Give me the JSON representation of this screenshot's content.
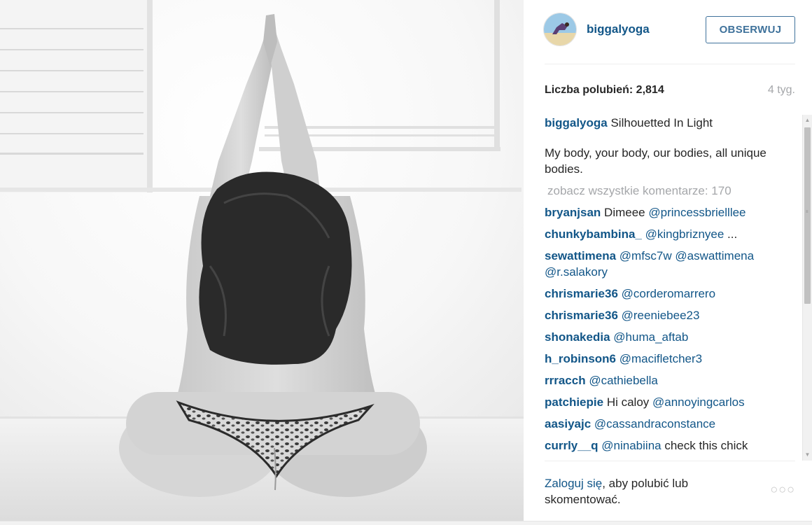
{
  "post": {
    "username": "biggalyoga",
    "follow_label": "OBSERWUJ",
    "likes_label": "Liczba polubień:",
    "likes_count": "2,814",
    "age": "4 tyg.",
    "caption_user": "biggalyoga",
    "caption_title": "Silhouetted In Light",
    "caption_body": "My body, your body, our bodies, all unique bodies.",
    "view_all_label": "zobacz wszystkie komentarze: 170"
  },
  "comments": [
    {
      "user": "bryanjsan",
      "pre": "Dimeee ",
      "mention": "@princessbrielllee",
      "post": ""
    },
    {
      "user": "chunkybambina_",
      "pre": "",
      "mention": "@kingbriznyee",
      "post": " ..."
    },
    {
      "user": "sewattimena",
      "pre": "",
      "mention": "@mfsc7w @aswattimena @r.salakory",
      "post": ""
    },
    {
      "user": "chrismarie36",
      "pre": "",
      "mention": "@corderomarrero",
      "post": ""
    },
    {
      "user": "chrismarie36",
      "pre": "",
      "mention": "@reeniebee23",
      "post": ""
    },
    {
      "user": "shonakedia",
      "pre": "",
      "mention": "@huma_aftab",
      "post": ""
    },
    {
      "user": "h_robinson6",
      "pre": "",
      "mention": "@macifletcher3",
      "post": ""
    },
    {
      "user": "rrracch",
      "pre": "",
      "mention": "@cathiebella",
      "post": ""
    },
    {
      "user": "patchiepie",
      "pre": "Hi caloy ",
      "mention": "@annoyingcarlos",
      "post": ""
    },
    {
      "user": "aasiyajc",
      "pre": "",
      "mention": "@cassandraconstance",
      "post": ""
    },
    {
      "user": "currly__q",
      "pre": "",
      "mention": "@ninabiina",
      "post": " check this chick"
    }
  ],
  "footer": {
    "login_link": "Zaloguj się",
    "login_rest": ", aby polubić lub skomentować.",
    "more_icon": "more-options-icon"
  },
  "colors": {
    "link": "#125688",
    "button_border": "#3f729b",
    "muted": "#a5a7aa",
    "text": "#262626"
  }
}
